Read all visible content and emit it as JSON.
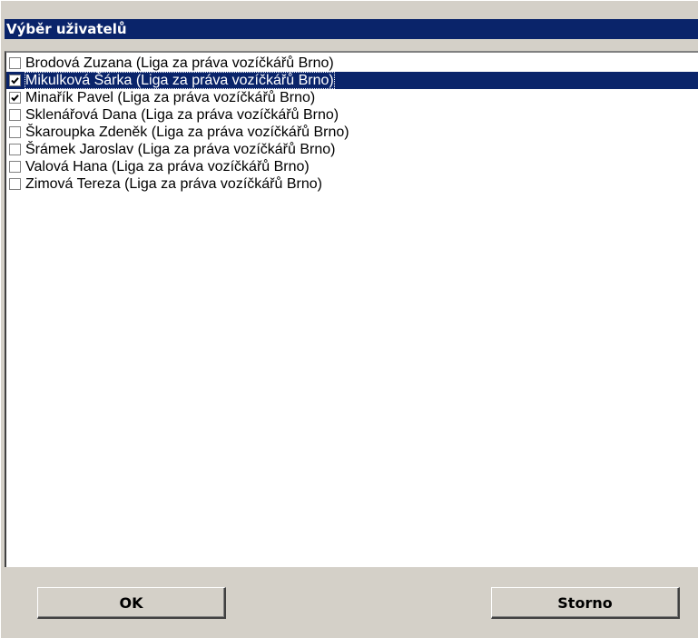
{
  "window": {
    "title": "Výběr uživatelů"
  },
  "users": [
    {
      "label": "Brodová Zuzana (Liga za práva vozíčkářů Brno)",
      "checked": false,
      "selected": false
    },
    {
      "label": "Mikulková Šárka (Liga za práva vozíčkářů Brno)",
      "checked": true,
      "selected": true
    },
    {
      "label": "Minařík Pavel (Liga za práva vozíčkářů Brno)",
      "checked": true,
      "selected": false
    },
    {
      "label": "Sklenářová Dana (Liga za práva vozíčkářů Brno)",
      "checked": false,
      "selected": false
    },
    {
      "label": "Škaroupka Zdeněk (Liga za práva vozíčkářů Brno)",
      "checked": false,
      "selected": false
    },
    {
      "label": "Šrámek Jaroslav (Liga za práva vozíčkářů Brno)",
      "checked": false,
      "selected": false
    },
    {
      "label": "Valová Hana (Liga za práva vozíčkářů Brno)",
      "checked": false,
      "selected": false
    },
    {
      "label": "Zimová Tereza (Liga za práva vozíčkářů Brno)",
      "checked": false,
      "selected": false
    }
  ],
  "buttons": {
    "ok_label": "OK",
    "cancel_label": "Storno"
  },
  "colors": {
    "selection": "#0a246a",
    "face": "#d4d0c8",
    "list_bg": "#ffffff"
  },
  "icons": {
    "checkbox_checked": "check-mark-icon"
  }
}
